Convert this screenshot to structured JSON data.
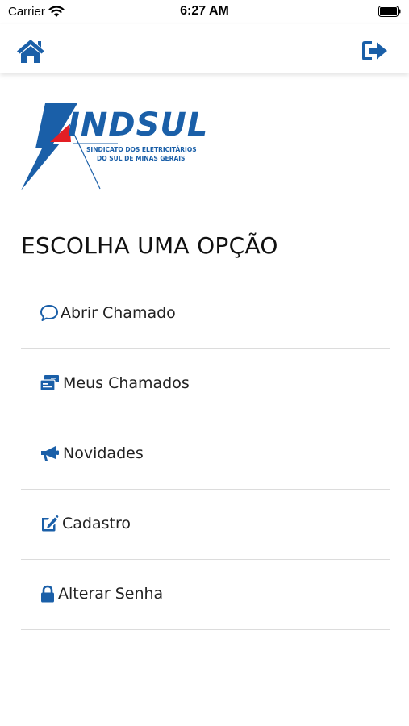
{
  "status_bar": {
    "carrier": "Carrier",
    "time": "6:27 AM"
  },
  "nav": {
    "home_icon": "home-icon",
    "logout_icon": "sign-out-icon",
    "accent_color": "#1a5fa8"
  },
  "logo": {
    "brand": "INDSUL",
    "subtitle_line1": "SINDICATO DOS ELETRICITÁRIOS",
    "subtitle_line2": "DO SUL DE MINAS GERAIS"
  },
  "heading": "ESCOLHA UMA OPÇÃO",
  "menu": {
    "items": [
      {
        "label": "Abrir Chamado",
        "icon": "comment-icon"
      },
      {
        "label": "Meus Chamados",
        "icon": "tickets-icon"
      },
      {
        "label": "Novidades",
        "icon": "megaphone-icon"
      },
      {
        "label": "Cadastro",
        "icon": "edit-icon"
      },
      {
        "label": "Alterar Senha",
        "icon": "lock-icon"
      }
    ]
  }
}
